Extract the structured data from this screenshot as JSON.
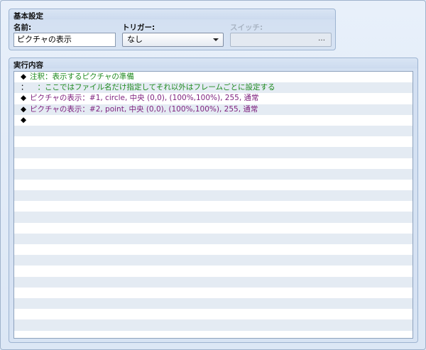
{
  "basic": {
    "title": "基本設定",
    "name_label": "名前:",
    "name_value": "ピクチャの表示",
    "trigger_label": "トリガー:",
    "trigger_value": "なし",
    "switch_label": "スイッチ:",
    "switch_button": "…"
  },
  "exec": {
    "title": "実行内容",
    "rows": [
      {
        "marker": "◆",
        "text": "注釈：表示するピクチャの準備",
        "color": "green"
      },
      {
        "marker": "：",
        "text": "　：ここではファイル名だけ指定してそれ以外はフレームごとに設定する",
        "color": "green"
      },
      {
        "marker": "◆",
        "text": "ピクチャの表示：#1, circle, 中央 (0,0), (100%,100%), 255, 通常",
        "color": "purple"
      },
      {
        "marker": "◆",
        "text": "ピクチャの表示：#2, point, 中央 (0,0), (100%,100%), 255, 通常",
        "color": "purple"
      },
      {
        "marker": "◆",
        "text": "",
        "color": "black"
      }
    ],
    "empty_rows": 20
  },
  "colors": {
    "comment": "#1f8a1f",
    "command": "#7d1f7d"
  }
}
